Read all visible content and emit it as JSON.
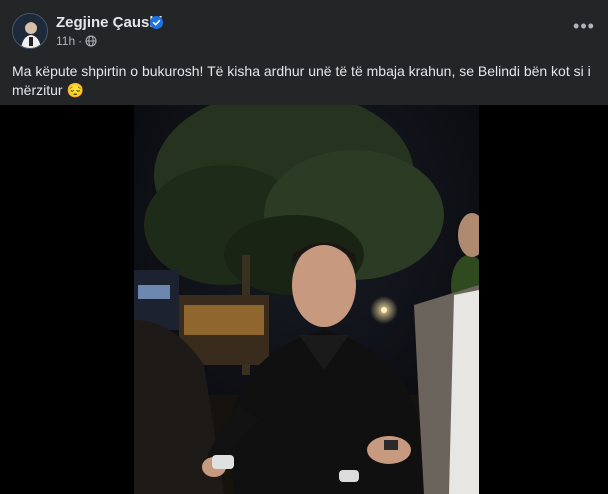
{
  "post": {
    "author": "Zegjine Çaushi",
    "time": "11h",
    "separator": "·",
    "audience_icon": "globe-icon",
    "verified_icon": "verified-badge-icon",
    "more_label": "•••",
    "text": "Ma këpute shpirtin o bukurosh! Të kisha ardhur unë të të mbaja krahun, se Belindi bën kot si i mërzitur 😔"
  },
  "video": {
    "description_icon": "video-player"
  },
  "colors": {
    "background": "#242526",
    "text_primary": "#e4e6eb",
    "text_secondary": "#b0b3b8",
    "verified": "#1b74e4",
    "video_bg": "#000000"
  }
}
